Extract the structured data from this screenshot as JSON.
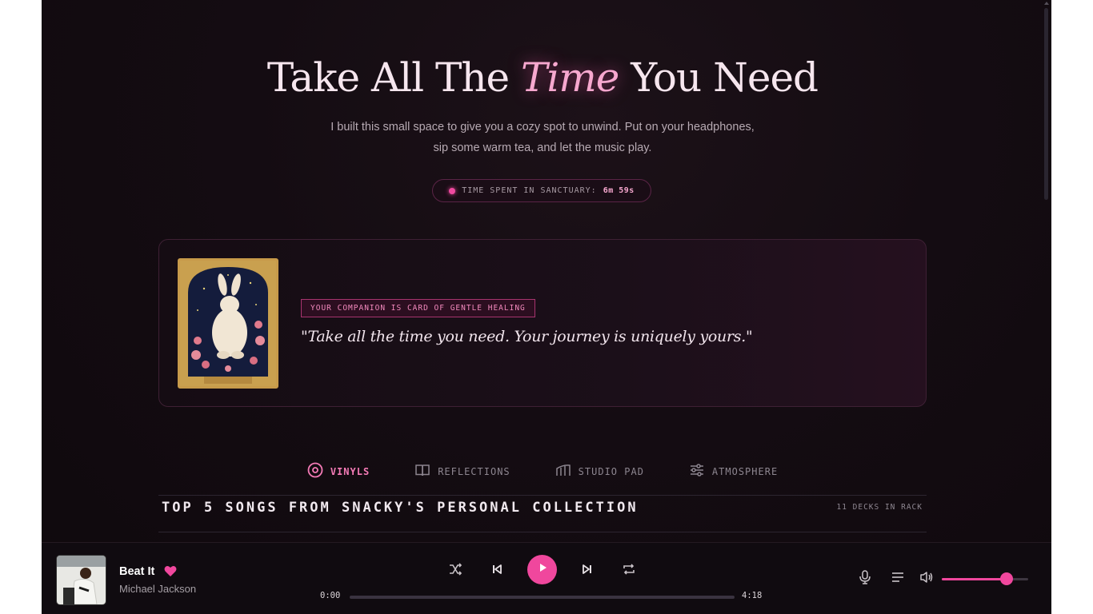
{
  "hero": {
    "title_before": "Take All The",
    "title_accent": "Time",
    "title_after": "You Need",
    "subtitle_line1": "I built this small space to give you a cozy spot to unwind. Put on your headphones,",
    "subtitle_line2": "sip some warm tea, and let the music play."
  },
  "timer": {
    "label": "TIME SPENT IN SANCTUARY:",
    "value": "6m 59s"
  },
  "companion": {
    "badge": "YOUR COMPANION IS CARD OF GENTLE HEALING",
    "quote": "\"Take all the time you need. Your journey is uniquely yours.\"",
    "card_icon": "rabbit-tarot-card"
  },
  "tabs": [
    {
      "label": "VINYLS",
      "icon": "vinyl-icon",
      "active": true
    },
    {
      "label": "REFLECTIONS",
      "icon": "book-icon",
      "active": false
    },
    {
      "label": "STUDIO PAD",
      "icon": "piano-icon",
      "active": false
    },
    {
      "label": "ATMOSPHERE",
      "icon": "sliders-icon",
      "active": false
    }
  ],
  "section": {
    "title": "TOP 5 SONGS FROM SNACKY'S PERSONAL COLLECTION",
    "count": "11 DECKS IN RACK"
  },
  "player": {
    "track_title": "Beat It",
    "artist": "Michael Jackson",
    "favorited": true,
    "current_time": "0:00",
    "duration": "4:18",
    "progress": 0,
    "volume": 0.75
  },
  "colors": {
    "accent": "#f0479d",
    "accent_light": "#f7a8cf",
    "background": "#140c12"
  }
}
